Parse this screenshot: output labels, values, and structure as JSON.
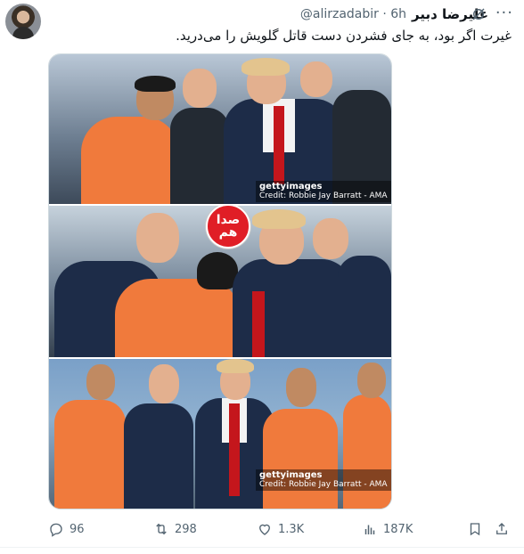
{
  "post": {
    "author": {
      "display_name": "علیرضا دبیر",
      "handle": "@alirzadabir",
      "time": "6h",
      "handle_time": "@alirzadabir · 6h"
    },
    "text": "غیرت اگر بود، به جای فشردن دست قاتل گلویش را می‌درید.",
    "media": {
      "photos": [
        {
          "watermark_brand": "gettyimages",
          "watermark_credit": "Credit: Robbie Jay Barratt - AMA"
        },
        {
          "logo_text": "صدا هم"
        },
        {
          "watermark_brand": "gettyimages",
          "watermark_credit": "Credit: Robbie Jay Barratt - AMA"
        }
      ]
    },
    "stats": {
      "replies": "96",
      "reposts": "298",
      "likes": "1.3K",
      "views": "187K"
    },
    "icons": {
      "grok": "grok-icon",
      "more": "more-icon",
      "reply": "reply-icon",
      "repost": "repost-icon",
      "like": "heart-icon",
      "views": "views-icon",
      "bookmark": "bookmark-icon",
      "share": "share-icon"
    }
  }
}
